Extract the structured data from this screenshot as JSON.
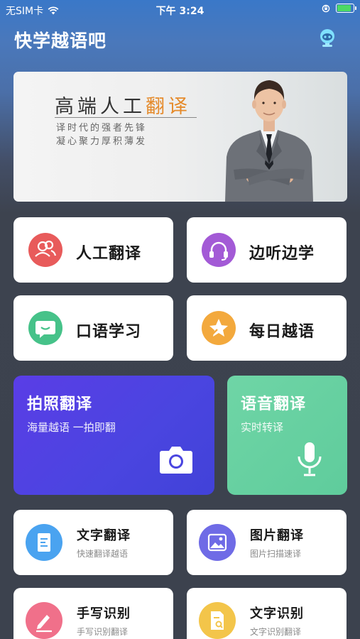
{
  "status_bar": {
    "carrier": "无SIM卡",
    "time": "下午 3:24"
  },
  "header": {
    "title": "快学越语吧"
  },
  "banner": {
    "title_prefix": "高端人工",
    "title_highlight": "翻译",
    "line1": "译时代的强者先锋",
    "line2": "凝心聚力厚积薄发"
  },
  "features": [
    {
      "label": "人工翻译",
      "icon": "people-icon",
      "color": "#e85b5b"
    },
    {
      "label": "边听边学",
      "icon": "headset-icon",
      "color": "#a35ad6"
    },
    {
      "label": "口语学习",
      "icon": "chat-icon",
      "color": "#46c289"
    },
    {
      "label": "每日越语",
      "icon": "star-icon",
      "color": "#f3a93d"
    }
  ],
  "big_cards": [
    {
      "title": "拍照翻译",
      "subtitle": "海量越语 一拍即翻",
      "icon": "camera-icon",
      "color": "#4b3fe0"
    },
    {
      "title": "语音翻译",
      "subtitle": "实时转译",
      "icon": "microphone-icon",
      "color": "#5fcc9c"
    }
  ],
  "tools": [
    {
      "title": "文字翻译",
      "subtitle": "快速翻译越语",
      "icon": "document-icon",
      "color": "#4aa3f0"
    },
    {
      "title": "图片翻译",
      "subtitle": "图片扫描速译",
      "icon": "image-icon",
      "color": "#6f6be6"
    },
    {
      "title": "手写识别",
      "subtitle": "手写识别翻译",
      "icon": "pen-icon",
      "color": "#f0708a"
    },
    {
      "title": "文字识别",
      "subtitle": "文字识别翻译",
      "icon": "scan-document-icon",
      "color": "#f3c54a"
    }
  ]
}
